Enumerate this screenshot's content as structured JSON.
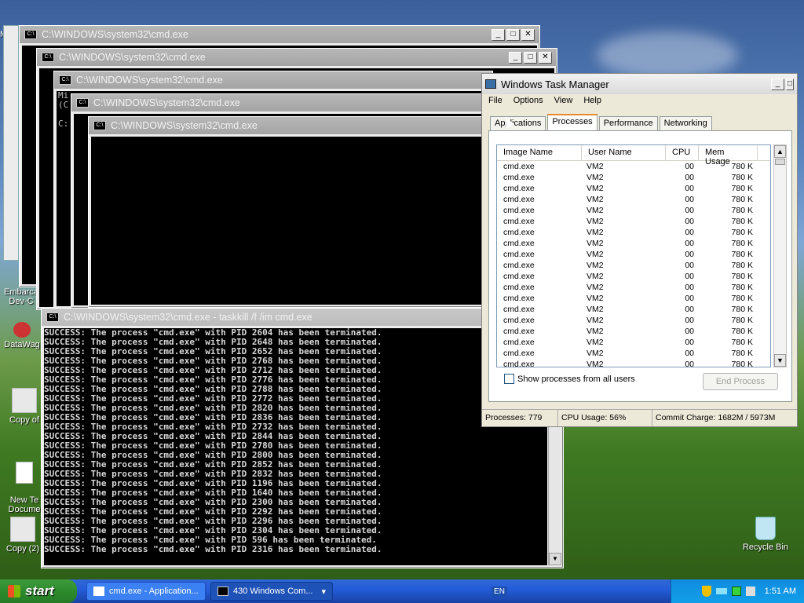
{
  "desktop": {
    "icons": [
      {
        "label": "My"
      },
      {
        "label": "Embarca\nDev-C"
      },
      {
        "label": "DataWag"
      },
      {
        "label": "Copy of"
      },
      {
        "label": "New Te\nDocume"
      },
      {
        "label": "Copy (2)"
      },
      {
        "label": "Recycle Bin"
      }
    ],
    "partial_letters": [
      "N",
      "C",
      "N"
    ]
  },
  "cmd_windows": [
    {
      "title": "C:\\WINDOWS\\system32\\cmd.exe"
    },
    {
      "title": "C:\\WINDOWS\\system32\\cmd.exe"
    },
    {
      "title": "C:\\WINDOWS\\system32\\cmd.exe",
      "snippet": "Mi\n(C\n\nC:"
    },
    {
      "title": "C:\\WINDOWS\\system32\\cmd.exe"
    },
    {
      "title": "C:\\WINDOWS\\system32\\cmd.exe"
    }
  ],
  "main_cmd": {
    "title": "C:\\WINDOWS\\system32\\cmd.exe - taskkill /f /im cmd.exe",
    "lines": [
      "SUCCESS: The process \"cmd.exe\" with PID 2604 has been terminated.",
      "SUCCESS: The process \"cmd.exe\" with PID 2648 has been terminated.",
      "SUCCESS: The process \"cmd.exe\" with PID 2652 has been terminated.",
      "SUCCESS: The process \"cmd.exe\" with PID 2768 has been terminated.",
      "SUCCESS: The process \"cmd.exe\" with PID 2712 has been terminated.",
      "SUCCESS: The process \"cmd.exe\" with PID 2776 has been terminated.",
      "SUCCESS: The process \"cmd.exe\" with PID 2788 has been terminated.",
      "SUCCESS: The process \"cmd.exe\" with PID 2772 has been terminated.",
      "SUCCESS: The process \"cmd.exe\" with PID 2820 has been terminated.",
      "SUCCESS: The process \"cmd.exe\" with PID 2836 has been terminated.",
      "SUCCESS: The process \"cmd.exe\" with PID 2732 has been terminated.",
      "SUCCESS: The process \"cmd.exe\" with PID 2844 has been terminated.",
      "SUCCESS: The process \"cmd.exe\" with PID 2780 has been terminated.",
      "SUCCESS: The process \"cmd.exe\" with PID 2800 has been terminated.",
      "SUCCESS: The process \"cmd.exe\" with PID 2852 has been terminated.",
      "SUCCESS: The process \"cmd.exe\" with PID 2832 has been terminated.",
      "SUCCESS: The process \"cmd.exe\" with PID 1196 has been terminated.",
      "SUCCESS: The process \"cmd.exe\" with PID 1640 has been terminated.",
      "SUCCESS: The process \"cmd.exe\" with PID 2300 has been terminated.",
      "SUCCESS: The process \"cmd.exe\" with PID 2292 has been terminated.",
      "SUCCESS: The process \"cmd.exe\" with PID 2296 has been terminated.",
      "SUCCESS: The process \"cmd.exe\" with PID 2304 has been terminated.",
      "SUCCESS: The process \"cmd.exe\" with PID 596 has been terminated.",
      "SUCCESS: The process \"cmd.exe\" with PID 2316 has been terminated."
    ]
  },
  "task_manager": {
    "title": "Windows Task Manager",
    "menu": [
      "File",
      "Options",
      "View",
      "Help"
    ],
    "tabs": [
      "Applications",
      "Processes",
      "Performance",
      "Networking"
    ],
    "selected_tab": "Processes",
    "columns": [
      "Image Name",
      "User Name",
      "CPU",
      "Mem Usage"
    ],
    "rows": [
      [
        "cmd.exe",
        "VM2",
        "00",
        "780 K"
      ],
      [
        "cmd.exe",
        "VM2",
        "00",
        "780 K"
      ],
      [
        "cmd.exe",
        "VM2",
        "00",
        "780 K"
      ],
      [
        "cmd.exe",
        "VM2",
        "00",
        "780 K"
      ],
      [
        "cmd.exe",
        "VM2",
        "00",
        "780 K"
      ],
      [
        "cmd.exe",
        "VM2",
        "00",
        "780 K"
      ],
      [
        "cmd.exe",
        "VM2",
        "00",
        "780 K"
      ],
      [
        "cmd.exe",
        "VM2",
        "00",
        "780 K"
      ],
      [
        "cmd.exe",
        "VM2",
        "00",
        "780 K"
      ],
      [
        "cmd.exe",
        "VM2",
        "00",
        "780 K"
      ],
      [
        "cmd.exe",
        "VM2",
        "00",
        "780 K"
      ],
      [
        "cmd.exe",
        "VM2",
        "00",
        "780 K"
      ],
      [
        "cmd.exe",
        "VM2",
        "00",
        "780 K"
      ],
      [
        "cmd.exe",
        "VM2",
        "00",
        "780 K"
      ],
      [
        "cmd.exe",
        "VM2",
        "00",
        "780 K"
      ],
      [
        "cmd.exe",
        "VM2",
        "00",
        "780 K"
      ],
      [
        "cmd.exe",
        "VM2",
        "00",
        "780 K"
      ],
      [
        "cmd.exe",
        "VM2",
        "00",
        "780 K"
      ],
      [
        "cmd.exe",
        "VM2",
        "00",
        "780 K"
      ]
    ],
    "show_all_label": "Show processes from all users",
    "end_process_label": "End Process",
    "status": {
      "processes": "Processes: 779",
      "cpu": "CPU Usage: 56%",
      "commit": "Commit Charge: 1682M / 5973M"
    }
  },
  "taskbar": {
    "start_label": "start",
    "tasks": [
      "cmd.exe - Application...",
      "430 Windows Com..."
    ],
    "tray": {
      "lang": "EN",
      "time": "1:51 AM"
    }
  }
}
